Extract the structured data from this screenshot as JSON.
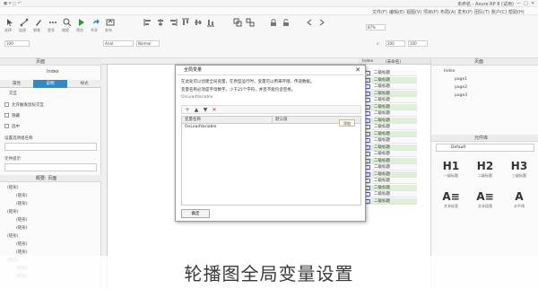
{
  "window": {
    "title": "未命名 - Axure RP 8 (试用)",
    "quick_access": "◼ ▾ ◻ ↶",
    "controls": [
      "—",
      "□",
      "✕"
    ]
  },
  "menu": {
    "items": [
      "文件(F)",
      "编辑(E)",
      "视图(V)",
      "项目(P)",
      "布局(A)",
      "发布(P)",
      "团队(T)",
      "账户(C)",
      "帮助(H)"
    ]
  },
  "toolbar": {
    "labels": [
      "选择",
      "连接",
      "钢笔",
      "更多",
      "缩放",
      "预览",
      "共享",
      "发布",
      "左侧",
      "居中",
      "右侧",
      "顶部",
      "中部",
      "底部",
      "组合",
      "取消组合",
      "对齐",
      "分布",
      "锁定",
      "解锁",
      "左",
      "右"
    ],
    "zoom_value": "100",
    "font_value": "Arial",
    "font_style": "Normal",
    "x_label": "x:",
    "w_value": "200",
    "h_value": "100",
    "pct_value": "87%"
  },
  "left_panel": {
    "title": "页面",
    "page_title": "Index",
    "tabs": [
      "属性",
      "说明",
      "样式"
    ],
    "active_tab": "属性",
    "interactions_label": "交互",
    "options": [
      {
        "label": "允许触发鼠标交互",
        "checked": false
      },
      {
        "label": "隐藏",
        "checked": false
      },
      {
        "label": "选中",
        "checked": false
      }
    ],
    "dropdown_label": "设置选项组名称",
    "text_label": "元件提示",
    "outline_title": "概要: 页面",
    "outline_rows": [
      "(矩形)",
      "(矩形)",
      "(矩形)",
      "(矩形)",
      "(矩形)",
      "(矩形)",
      "(矩形)",
      "(矩形)",
      "(矩形)",
      "(矩形)",
      "(矩形)",
      "(矩形)"
    ]
  },
  "canvas": {
    "tabs": [
      "Index",
      "(未命名)"
    ],
    "grid_rows": [
      "二级标题",
      "二级标题",
      "二级标题",
      "二级标题",
      "二级标题",
      "二级标题",
      "二级标题",
      "二级标题",
      "二级标题",
      "二级标题",
      "二级标题",
      "二级标题",
      "二级标题",
      "二级标题",
      "二级标题",
      "二级标题",
      "二级标题",
      "二级标题",
      "二级标题",
      "二级标题"
    ]
  },
  "right_panel": {
    "pages_title": "页面",
    "pages": [
      "Index",
      "page1",
      "page2",
      "page3"
    ],
    "library_title": "元件库",
    "library_select": "Default",
    "widgets": [
      {
        "big": "H1",
        "label": "一级标题"
      },
      {
        "big": "H2",
        "label": "二级标题"
      },
      {
        "big": "H3",
        "label": "三级标题"
      },
      {
        "big": "A≡",
        "label": "文本标签"
      },
      {
        "big": "A≡",
        "label": "文本段落"
      },
      {
        "big": "A",
        "label": "水平线"
      }
    ]
  },
  "dialog": {
    "title": "全局变量",
    "desc_line1": "在此处可以创建全局变量，在原型运行时，变量可以用来存储、传递数据。",
    "desc_line2": "变量名称必须是字母数字，少于25个字符，并且不能包含空格。",
    "desc_line3": "OnLoadVariable",
    "tools": [
      "+",
      "▲",
      "▼",
      "✕"
    ],
    "columns": [
      "变量名称",
      "默认值"
    ],
    "rows": [
      {
        "name": "OnLoadVariable",
        "value": ""
      }
    ],
    "ok_label": "确定",
    "tooltip": "添加"
  },
  "caption": "轮播图全局变量设置",
  "colors": {
    "accent": "#2f8ac7",
    "highlight": "#dff0d8"
  }
}
